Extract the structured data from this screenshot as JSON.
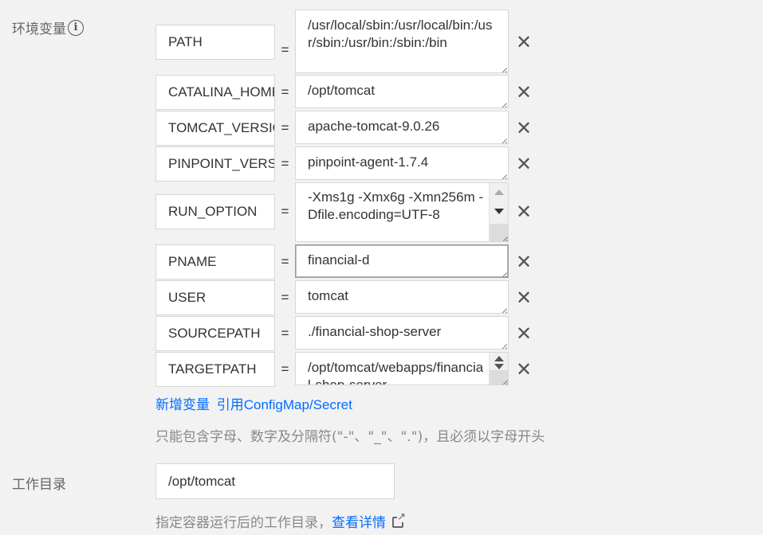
{
  "env_section": {
    "label": "环境变量",
    "info_icon": "info-icon",
    "equals": "=",
    "delete_icon": "close-icon",
    "rows": [
      {
        "key": "PATH",
        "value": "/usr/local/sbin:/usr/local/bin:/usr/sbin:/usr/bin:/sbin:/bin"
      },
      {
        "key": "CATALINA_HOME",
        "value": "/opt/tomcat"
      },
      {
        "key": "TOMCAT_VERSION",
        "value": "apache-tomcat-9.0.26"
      },
      {
        "key": "PINPOINT_VERSION",
        "value": "pinpoint-agent-1.7.4"
      },
      {
        "key": "RUN_OPTION",
        "value": "-Xms1g -Xmx6g -Xmn256m -Dfile.encoding=UTF-8"
      },
      {
        "key": "PNAME",
        "value": "financial-d"
      },
      {
        "key": "USER",
        "value": "tomcat"
      },
      {
        "key": "SOURCEPATH",
        "value": "./financial-shop-server"
      },
      {
        "key": "TARGETPATH",
        "value": "/opt/tomcat/webapps/financial-shop-server"
      }
    ],
    "add_link": "新增变量",
    "ref_link": "引用ConfigMap/Secret",
    "hint": "只能包含字母、数字及分隔符(\"-\"、\"_\"、\".\")，且必须以字母开头"
  },
  "workdir_section": {
    "label": "工作目录",
    "value": "/opt/tomcat",
    "hint": "指定容器运行后的工作目录，",
    "detail_link": "查看详情",
    "external_icon": "external-link-icon"
  }
}
